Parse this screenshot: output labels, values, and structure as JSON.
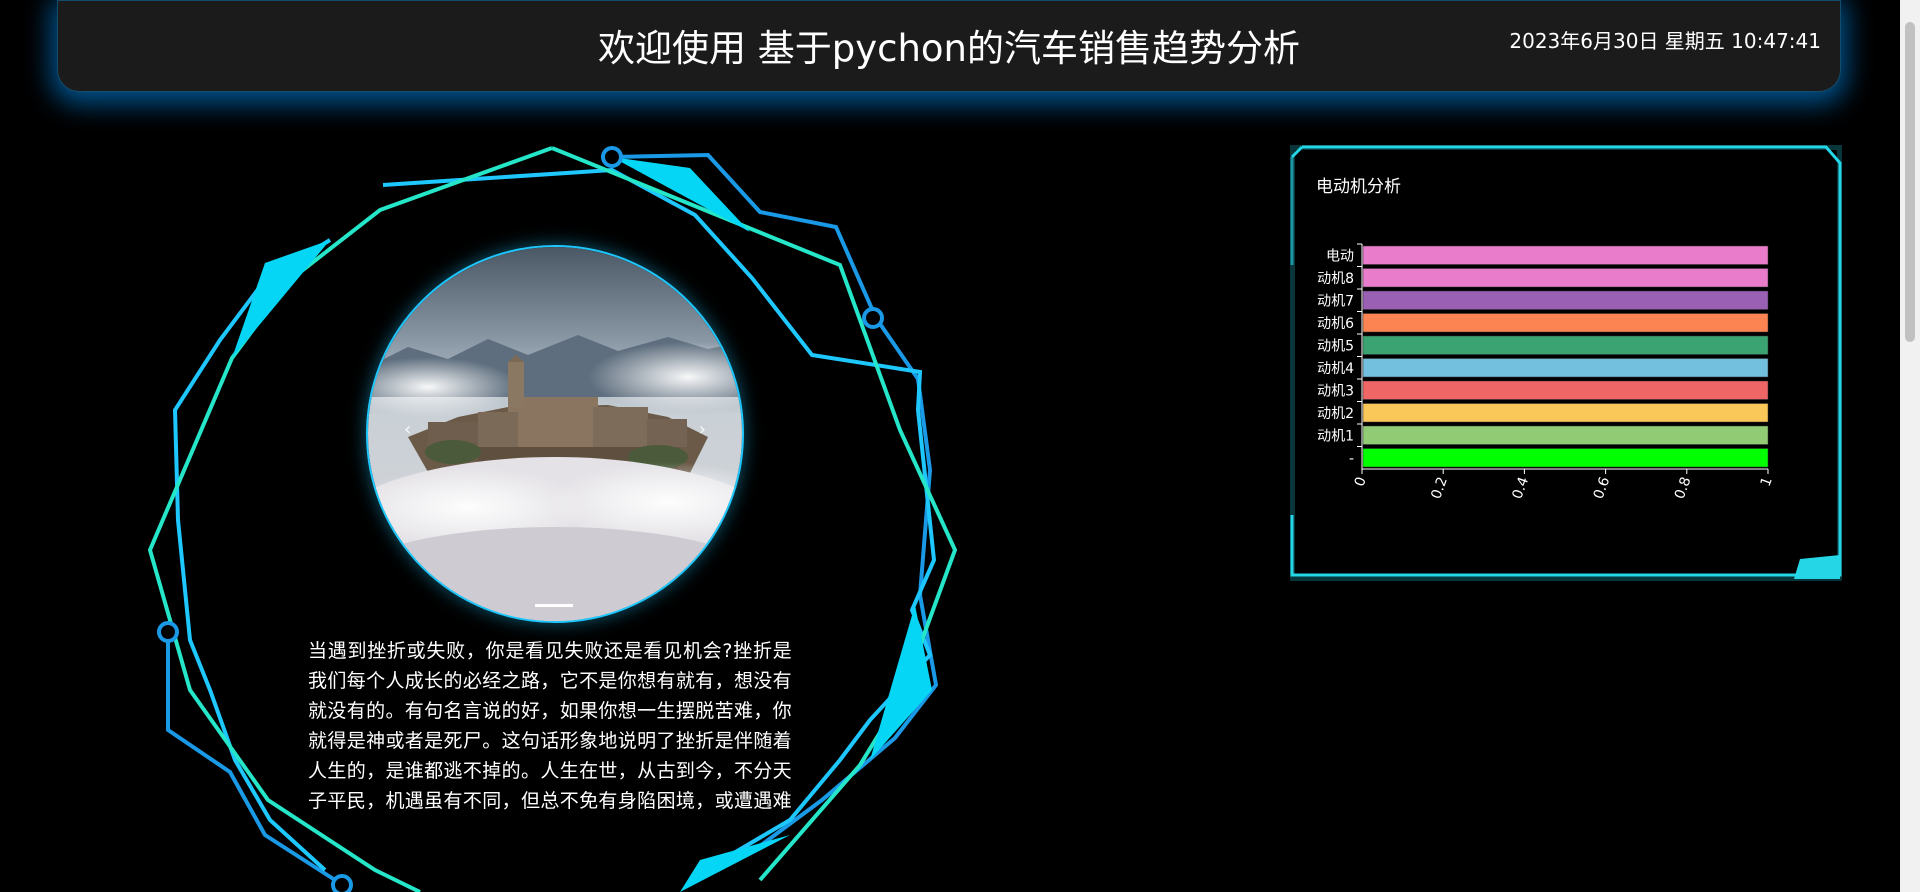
{
  "header": {
    "title": "欢迎使用 基于pychon的汽车销售趋势分析",
    "datetime": "2023年6月30日 星期五 10:47:41"
  },
  "carousel": {
    "prev_icon": "chevron-left-icon",
    "next_icon": "chevron-right-icon",
    "prev_glyph": "‹",
    "next_glyph": "›"
  },
  "article": {
    "text": "当遇到挫折或失败，你是看见失败还是看见机会?挫折是我们每个人成长的必经之路，它不是你想有就有，想没有就没有的。有句名言说的好，如果你想一生摆脱苦难，你就得是神或者是死尸。这句话形象地说明了挫折是伴随着人生的，是谁都逃不掉的。人生在世，从古到今，不分天子平民，机遇虽有不同，但总不免有身陷困境，或遭遇难题之处。"
  },
  "panel": {
    "title": "电动机分析"
  },
  "colors": {
    "accent": "#1ec8ff",
    "accent2": "#25e6c8"
  },
  "chart_data": {
    "type": "bar",
    "orientation": "horizontal",
    "categories": [
      "-",
      "动机1",
      "动机2",
      "动机3",
      "动机4",
      "动机5",
      "动机6",
      "动机7",
      "动机8",
      "电动"
    ],
    "values": [
      1,
      1,
      1,
      1,
      1,
      1,
      1,
      1,
      1,
      1
    ],
    "colors": [
      "#00ff00",
      "#91cc75",
      "#fac858",
      "#ee6666",
      "#73c0de",
      "#3ba272",
      "#fc8452",
      "#9a60b4",
      "#ea7ccc",
      "#ea7ccc"
    ],
    "xticks": [
      "0",
      "0.2",
      "0.4",
      "0.6",
      "0.8",
      "1"
    ],
    "xlim": [
      0,
      1
    ]
  }
}
